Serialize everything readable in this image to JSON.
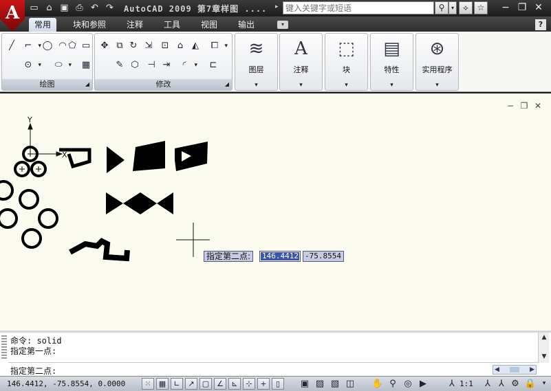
{
  "app": {
    "logo_letter": "A",
    "title": "AutoCAD 2009  第7章样图 ....",
    "search_placeholder": "键入关键字或短语"
  },
  "ribbon": {
    "tabs": [
      {
        "label": "常用",
        "active": true
      },
      {
        "label": "块和参照",
        "active": false
      },
      {
        "label": "注释",
        "active": false
      },
      {
        "label": "工具",
        "active": false
      },
      {
        "label": "视图",
        "active": false
      },
      {
        "label": "输出",
        "active": false
      }
    ],
    "panels": {
      "draw_title": "绘图",
      "modify_title": "修改",
      "layers_label": "图层",
      "annotation_label": "注释",
      "block_label": "块",
      "properties_label": "特性",
      "utilities_label": "实用程序"
    }
  },
  "drawing": {
    "ucs_y": "Y",
    "ucs_x": "X",
    "dynamic_prompt": "指定第二点:",
    "dynamic_x": "146.4412",
    "dynamic_y": "-75.8554"
  },
  "command": {
    "history": [
      "命令: solid",
      "指定第一点:"
    ],
    "current": "指定第二点:"
  },
  "status": {
    "coords": "146.4412, -75.8554, 0.0000",
    "scale": "1:1"
  },
  "colors": {
    "canvas": "#fcfbf0",
    "title_bar": "#2a2a2a",
    "prompt_box": "#c8cbe4",
    "selection": "#3b55a8"
  }
}
